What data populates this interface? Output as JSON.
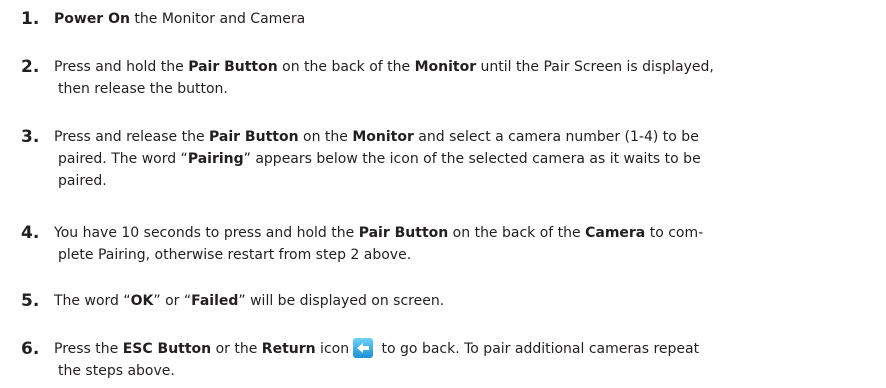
{
  "steps": [
    {
      "number": "1.",
      "parts": [
        {
          "t": "Power On",
          "b": true
        },
        {
          "t": " the Monitor and Camera"
        }
      ]
    },
    {
      "number": "2.",
      "parts": [
        {
          "t": "Press and hold the "
        },
        {
          "t": "Pair Button",
          "b": true
        },
        {
          "t": " on the back of the "
        },
        {
          "t": "Monitor",
          "b": true
        },
        {
          "t": " until the Pair Screen is displayed,"
        }
      ],
      "cont": "then release the button."
    },
    {
      "number": "3.",
      "parts": [
        {
          "t": "Press and release the "
        },
        {
          "t": "Pair Button",
          "b": true
        },
        {
          "t": " on the "
        },
        {
          "t": "Monitor",
          "b": true
        },
        {
          "t": " and select a camera number (1-4) to be"
        }
      ],
      "cont": "paired. The word “Pairing” appears below the icon of the selected camera as it waits to be",
      "cont2": "paired."
    },
    {
      "number": "4.",
      "parts": [
        {
          "t": "You have 10 seconds to press and hold the "
        },
        {
          "t": "Pair Button",
          "b": true
        },
        {
          "t": " on the back of the "
        },
        {
          "t": "Camera",
          "b": true
        },
        {
          "t": " to com-"
        }
      ],
      "cont": "plete Pairing, otherwise restart from step 2 above."
    },
    {
      "number": "5.",
      "parts": [
        {
          "t": "The word “"
        },
        {
          "t": "OK",
          "b": true
        },
        {
          "t": "” or “"
        },
        {
          "t": "Failed",
          "b": true
        },
        {
          "t": "” will be displayed on screen."
        }
      ]
    },
    {
      "number": "6.",
      "parts": [
        {
          "t": "Press the "
        },
        {
          "t": "ESC Button",
          "b": true
        },
        {
          "t": " or the "
        },
        {
          "t": "Return",
          "b": true
        },
        {
          "t": " icon"
        },
        {
          "icon": "return-icon"
        },
        {
          "t": " to go back.  To pair additional cameras repeat"
        }
      ],
      "cont": "the steps above."
    }
  ]
}
